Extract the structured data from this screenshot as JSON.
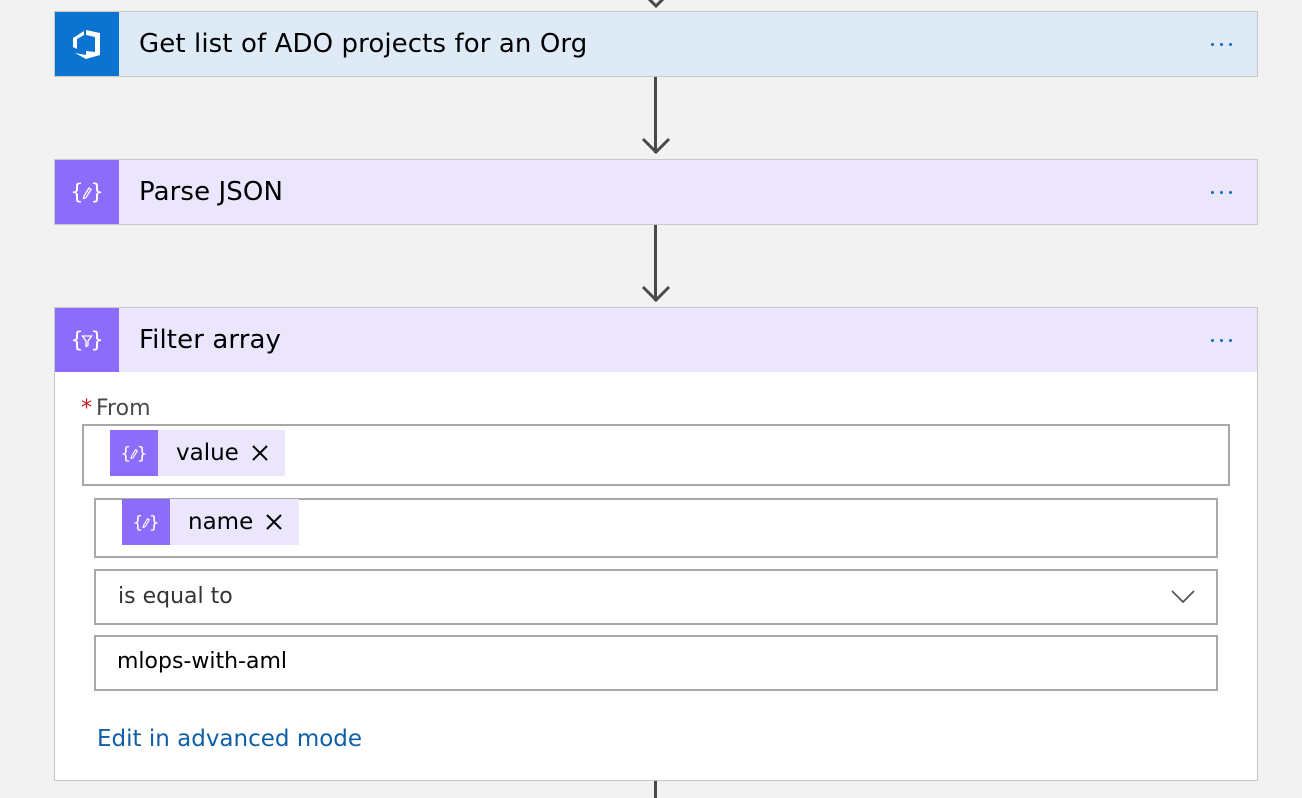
{
  "flow": {
    "steps": [
      {
        "title": "Get list of ADO projects for an Org",
        "icon": "azure-devops-icon",
        "more_icon": "ellipsis-icon"
      },
      {
        "title": "Parse JSON",
        "icon": "data-operation-icon",
        "more_icon": "ellipsis-icon"
      },
      {
        "title": "Filter array",
        "icon": "filter-array-icon",
        "more_icon": "ellipsis-icon"
      }
    ]
  },
  "filter_array": {
    "from": {
      "required_marker": "*",
      "label": "From",
      "token": {
        "label": "value",
        "icon": "data-operation-icon"
      }
    },
    "condition": {
      "left_token": {
        "label": "name",
        "icon": "data-operation-icon"
      },
      "operator": "is equal to",
      "value": "mlops-with-aml"
    },
    "advanced_mode_link": "Edit in advanced mode"
  },
  "colors": {
    "canvas": "#f2f2f2",
    "ado_header": "#deebf7",
    "ado_icon": "#0b74d1",
    "data_op_header": "#ebe6fd",
    "data_op_icon": "#8c6cfa",
    "link": "#0f5fa8",
    "required": "#d01818"
  }
}
